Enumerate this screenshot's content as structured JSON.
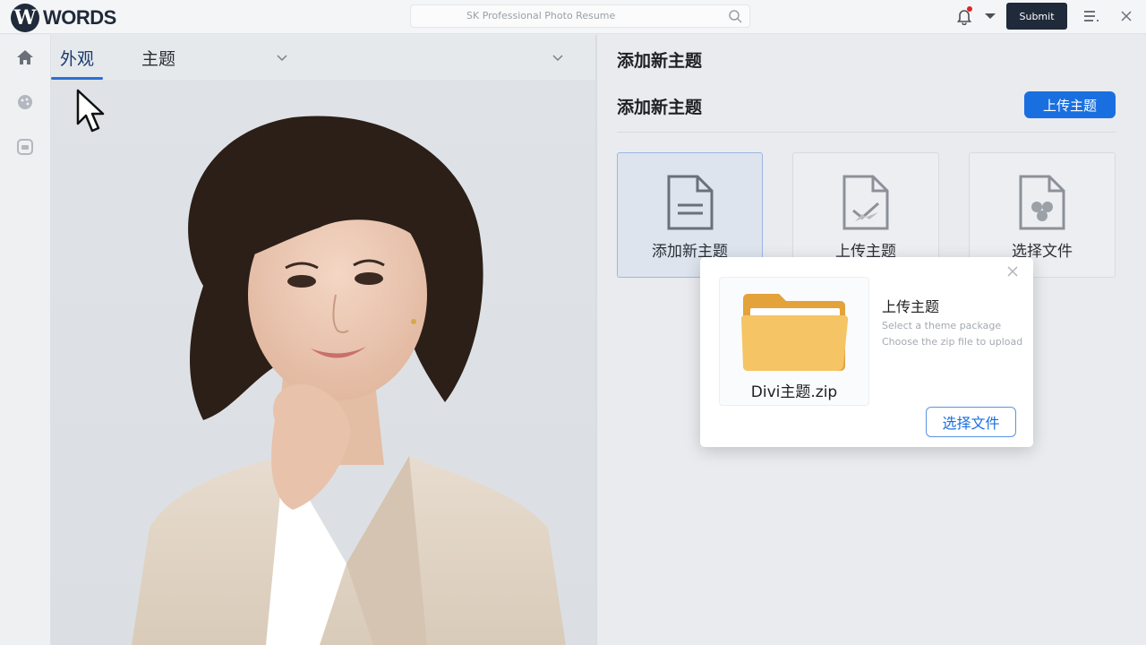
{
  "app": {
    "logo_mark": "W",
    "logo_text": "WORDS"
  },
  "topbar": {
    "search_text": "SK Professional Photo Resume",
    "button_label": "Submit",
    "icons": [
      "search-icon",
      "bell-icon",
      "caret-down-icon",
      "menu-icon",
      "close-icon"
    ]
  },
  "rail": {
    "icons": [
      "home-icon",
      "palette-icon",
      "widget-icon"
    ]
  },
  "left_tabs": [
    {
      "label": "外观",
      "active": true
    },
    {
      "label": "主题",
      "active": false
    }
  ],
  "right": {
    "title": "添加新主题",
    "subtitle": "添加新主题",
    "upload_button": "上传主题",
    "cards": [
      {
        "label": "添加新主题",
        "icon": "document-icon",
        "active": true
      },
      {
        "label": "上传主题",
        "icon": "upload-file-icon",
        "active": false
      },
      {
        "label": "选择文件",
        "icon": "file-select-icon",
        "active": false
      }
    ]
  },
  "dialog": {
    "file_name": "Divi主题.zip",
    "title": "上传主题",
    "line1": "Select a theme package",
    "line2": "Choose the zip file to upload",
    "button": "选择文件"
  },
  "colors": {
    "accent": "#1a6fe0",
    "dark": "#1f2a3a",
    "notification": "#e02424",
    "folder": "#f2b94f"
  }
}
